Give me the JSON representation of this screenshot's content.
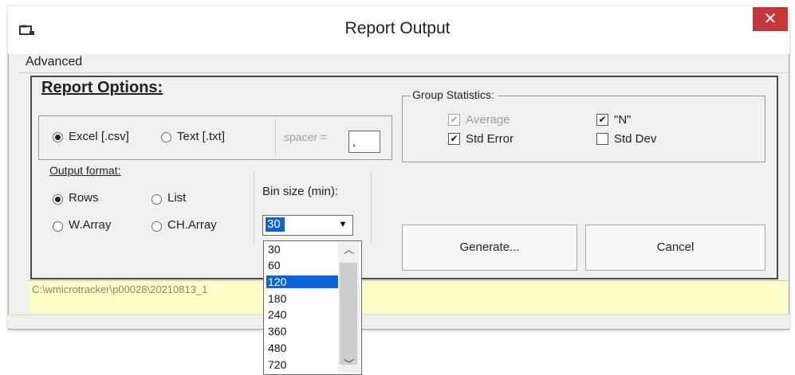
{
  "window": {
    "title": "Report Output",
    "close_label": "✕"
  },
  "menu": {
    "advanced": "Advanced"
  },
  "report_options": {
    "title": "Report Options:",
    "formats": [
      {
        "label": "Excel [.csv]",
        "selected": true
      },
      {
        "label": "Text [.txt]",
        "selected": false
      }
    ],
    "spacer_label": "spacer =",
    "spacer_value": ","
  },
  "output_format": {
    "label": "Output format:",
    "options": [
      {
        "label": "Rows",
        "selected": true
      },
      {
        "label": "List",
        "selected": false
      },
      {
        "label": "W.Array",
        "selected": false
      },
      {
        "label": "CH.Array",
        "selected": false
      }
    ]
  },
  "bin_size": {
    "label": "Bin size (min):",
    "value": "30",
    "options": [
      "30",
      "60",
      "120",
      "180",
      "240",
      "360",
      "480",
      "720"
    ],
    "highlighted": "120"
  },
  "group_statistics": {
    "label": "Group Statistics:",
    "items": [
      {
        "label": "Average",
        "checked": true,
        "disabled": true
      },
      {
        "label": "\"N\"",
        "checked": true,
        "disabled": false
      },
      {
        "label": "Std Error",
        "checked": true,
        "disabled": false
      },
      {
        "label": "Std Dev",
        "checked": false,
        "disabled": false
      }
    ]
  },
  "buttons": {
    "generate": "Generate...",
    "cancel": "Cancel"
  },
  "path": {
    "text": "C:\\wmicrotracker\\p00028\\20210813_1"
  },
  "colors": {
    "close_button": "#c8353a",
    "selection": "#0a64d8",
    "path_bar": "#fdfdc8"
  }
}
